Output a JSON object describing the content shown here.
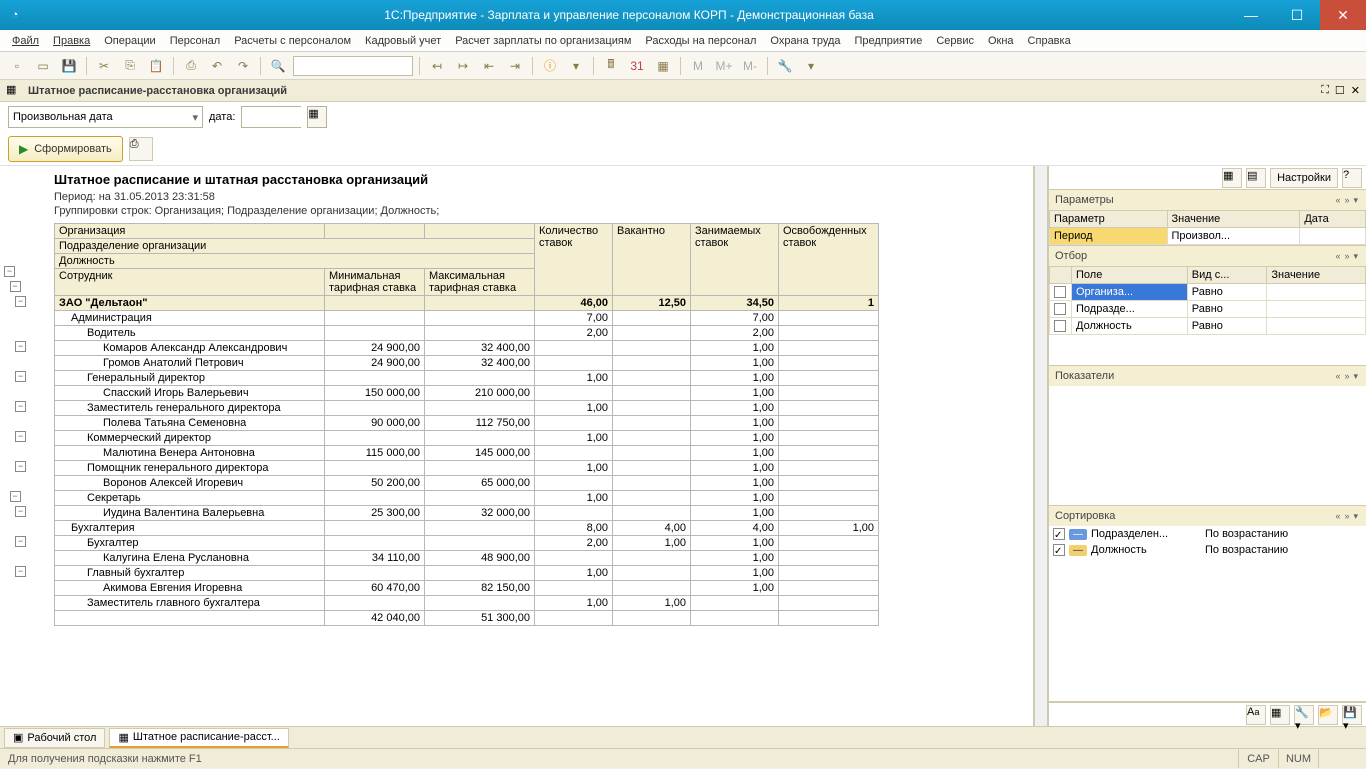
{
  "window_title": "1С:Предприятие - Зарплата и управление персоналом КОРП - Демонстрационная база",
  "menu": [
    "Файл",
    "Правка",
    "Операции",
    "Персонал",
    "Расчеты с персоналом",
    "Кадровый учет",
    "Расчет зарплаты по организациям",
    "Расходы на персонал",
    "Охрана труда",
    "Предприятие",
    "Сервис",
    "Окна",
    "Справка"
  ],
  "subwin": "Штатное расписание-расстановка организаций",
  "date_combo": "Произвольная дата",
  "date_label": "дата:",
  "form_btn": "Сформировать",
  "report": {
    "title": "Штатное расписание и штатная расстановка организаций",
    "period": "Период: на 31.05.2013 23:31:58",
    "group": "Группировки строк: Организация; Подразделение организации; Должность;",
    "head1": [
      "Организация",
      "Количество ставок",
      "Вакантно",
      "Занимаемых ставок",
      "Освобожденных ставок"
    ],
    "head2": "Подразделение организации",
    "head3": "Должность",
    "head4": [
      "Сотрудник",
      "Минимальная тарифная ставка",
      "Максимальная тарифная ставка"
    ],
    "rows": [
      {
        "l": 0,
        "n": "ЗАО \"Дельтаон\"",
        "v": [
          "",
          "",
          "46,00",
          "12,50",
          "34,50",
          "1"
        ]
      },
      {
        "l": 1,
        "n": "Администрация",
        "v": [
          "",
          "",
          "7,00",
          "",
          "7,00",
          ""
        ]
      },
      {
        "l": 2,
        "n": "Водитель",
        "v": [
          "",
          "",
          "2,00",
          "",
          "2,00",
          ""
        ]
      },
      {
        "l": 3,
        "n": "Комаров Александр Александрович",
        "v": [
          "24 900,00",
          "32 400,00",
          "",
          "",
          "1,00",
          ""
        ]
      },
      {
        "l": 3,
        "n": "Громов Анатолий Петрович",
        "v": [
          "24 900,00",
          "32 400,00",
          "",
          "",
          "1,00",
          ""
        ]
      },
      {
        "l": 2,
        "n": "Генеральный директор",
        "v": [
          "",
          "",
          "1,00",
          "",
          "1,00",
          ""
        ]
      },
      {
        "l": 3,
        "n": "Спасский Игорь Валерьевич",
        "v": [
          "150 000,00",
          "210 000,00",
          "",
          "",
          "1,00",
          ""
        ]
      },
      {
        "l": 2,
        "n": "Заместитель генерального директора",
        "v": [
          "",
          "",
          "1,00",
          "",
          "1,00",
          ""
        ]
      },
      {
        "l": 3,
        "n": "Полева Татьяна Семеновна",
        "v": [
          "90 000,00",
          "112 750,00",
          "",
          "",
          "1,00",
          ""
        ]
      },
      {
        "l": 2,
        "n": "Коммерческий директор",
        "v": [
          "",
          "",
          "1,00",
          "",
          "1,00",
          ""
        ]
      },
      {
        "l": 3,
        "n": "Малютина Венера Антоновна",
        "v": [
          "115 000,00",
          "145 000,00",
          "",
          "",
          "1,00",
          ""
        ]
      },
      {
        "l": 2,
        "n": "Помощник генерального директора",
        "v": [
          "",
          "",
          "1,00",
          "",
          "1,00",
          ""
        ]
      },
      {
        "l": 3,
        "n": "Воронов Алексей Игоревич",
        "v": [
          "50 200,00",
          "65 000,00",
          "",
          "",
          "1,00",
          ""
        ]
      },
      {
        "l": 2,
        "n": "Секретарь",
        "v": [
          "",
          "",
          "1,00",
          "",
          "1,00",
          ""
        ]
      },
      {
        "l": 3,
        "n": "Иудина Валентина Валерьевна",
        "v": [
          "25 300,00",
          "32 000,00",
          "",
          "",
          "1,00",
          ""
        ]
      },
      {
        "l": 1,
        "n": "Бухгалтерия",
        "v": [
          "",
          "",
          "8,00",
          "4,00",
          "4,00",
          "1,00"
        ]
      },
      {
        "l": 2,
        "n": "Бухгалтер",
        "v": [
          "",
          "",
          "2,00",
          "1,00",
          "1,00",
          ""
        ]
      },
      {
        "l": 3,
        "n": "Калугина Елена Руслановна",
        "v": [
          "34 110,00",
          "48 900,00",
          "",
          "",
          "1,00",
          ""
        ]
      },
      {
        "l": 2,
        "n": "Главный бухгалтер",
        "v": [
          "",
          "",
          "1,00",
          "",
          "1,00",
          ""
        ]
      },
      {
        "l": 3,
        "n": "Акимова Евгения Игоревна",
        "v": [
          "60 470,00",
          "82 150,00",
          "",
          "",
          "1,00",
          ""
        ]
      },
      {
        "l": 2,
        "n": "Заместитель главного бухгалтера",
        "v": [
          "",
          "",
          "1,00",
          "1,00",
          "",
          ""
        ]
      },
      {
        "l": 3,
        "n": "",
        "v": [
          "42 040,00",
          "51 300,00",
          "",
          "",
          "",
          ""
        ]
      }
    ]
  },
  "side": {
    "settings": "Настройки",
    "params": {
      "title": "Параметры",
      "cols": [
        "Параметр",
        "Значение",
        "Дата"
      ],
      "rows": [
        [
          "Период",
          "Произвол...",
          ""
        ]
      ]
    },
    "filter": {
      "title": "Отбор",
      "cols": [
        "",
        "Поле",
        "Вид с...",
        "Значение"
      ],
      "rows": [
        [
          "",
          "Организа...",
          "Равно",
          ""
        ],
        [
          "",
          "Подразде...",
          "Равно",
          ""
        ],
        [
          "",
          "Должность",
          "Равно",
          ""
        ]
      ]
    },
    "indicators": {
      "title": "Показатели"
    },
    "sort": {
      "title": "Сортировка",
      "rows": [
        [
          "Подразделен...",
          "По возрастанию"
        ],
        [
          "Должность",
          "По возрастанию"
        ]
      ]
    }
  },
  "tasks": [
    "Рабочий стол",
    "Штатное расписание-расст..."
  ],
  "status": "Для получения подсказки нажмите F1",
  "cap": "CAP",
  "num": "NUM"
}
